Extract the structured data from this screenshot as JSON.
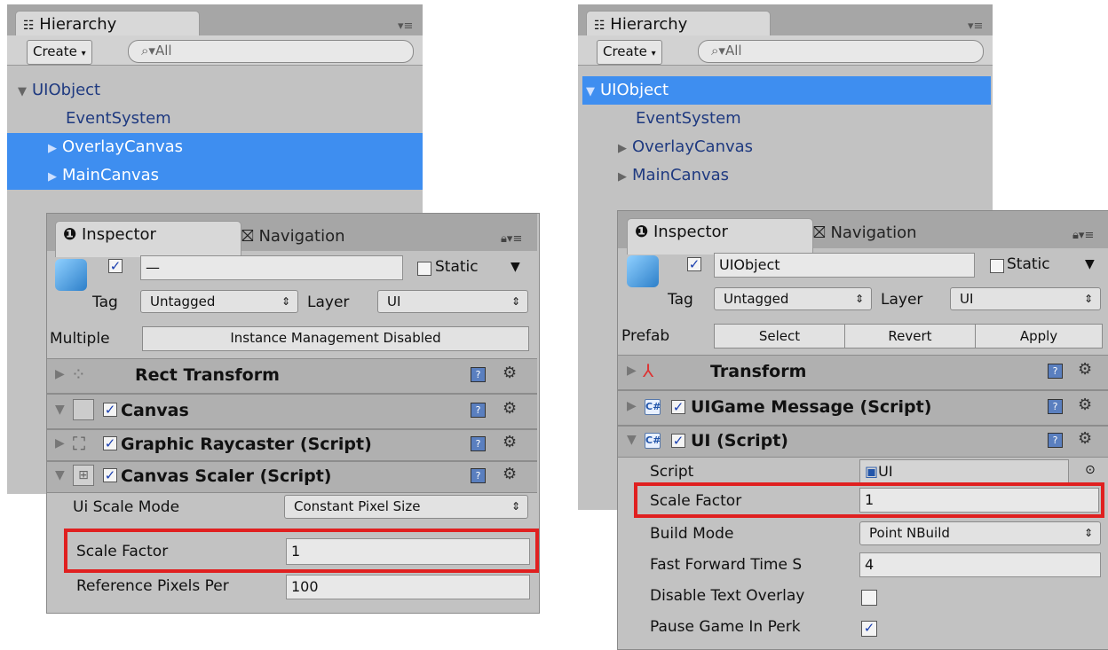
{
  "left": {
    "hierarchy": {
      "tab": "Hierarchy",
      "create": "Create",
      "search_placeholder": "All",
      "items": [
        {
          "label": "UIObject"
        },
        {
          "label": "EventSystem"
        },
        {
          "label": "OverlayCanvas"
        },
        {
          "label": "MainCanvas"
        }
      ]
    },
    "inspector": {
      "tab": "Inspector",
      "nav_tab": "Navigation",
      "name_value": "—",
      "static_label": "Static",
      "tag_label": "Tag",
      "tag_value": "Untagged",
      "layer_label": "Layer",
      "layer_value": "UI",
      "multiple_label": "Multiple",
      "instance_btn": "Instance Management Disabled",
      "components": [
        {
          "title": "Rect Transform"
        },
        {
          "title": "Canvas"
        },
        {
          "title": "Graphic Raycaster (Script)"
        },
        {
          "title": "Canvas Scaler (Script)"
        }
      ],
      "ui_scale_mode_label": "Ui Scale Mode",
      "ui_scale_mode_value": "Constant Pixel Size",
      "scale_factor_label": "Scale Factor",
      "scale_factor_value": "1",
      "ref_pixels_label": "Reference Pixels Per",
      "ref_pixels_value": "100"
    }
  },
  "right": {
    "hierarchy": {
      "tab": "Hierarchy",
      "create": "Create",
      "search_placeholder": "All",
      "items": [
        {
          "label": "UIObject"
        },
        {
          "label": "EventSystem"
        },
        {
          "label": "OverlayCanvas"
        },
        {
          "label": "MainCanvas"
        }
      ]
    },
    "inspector": {
      "tab": "Inspector",
      "nav_tab": "Navigation",
      "name_value": "UIObject",
      "static_label": "Static",
      "tag_label": "Tag",
      "tag_value": "Untagged",
      "layer_label": "Layer",
      "layer_value": "UI",
      "prefab_label": "Prefab",
      "prefab_select": "Select",
      "prefab_revert": "Revert",
      "prefab_apply": "Apply",
      "components": [
        {
          "title": "Transform"
        },
        {
          "title": "UIGame Message (Script)"
        },
        {
          "title": "UI (Script)"
        }
      ],
      "script_label": "Script",
      "script_value": "UI",
      "scale_factor_label": "Scale Factor",
      "scale_factor_value": "1",
      "build_mode_label": "Build Mode",
      "build_mode_value": "Point NBuild",
      "fast_forward_label": "Fast Forward Time S",
      "fast_forward_value": "4",
      "disable_text_label": "Disable Text Overlay",
      "pause_game_label": "Pause Game In Perk"
    }
  },
  "colors": {
    "selection": "#3e8ef0",
    "highlight_box": "#e02020",
    "panel_bg": "#c2c2c2"
  }
}
